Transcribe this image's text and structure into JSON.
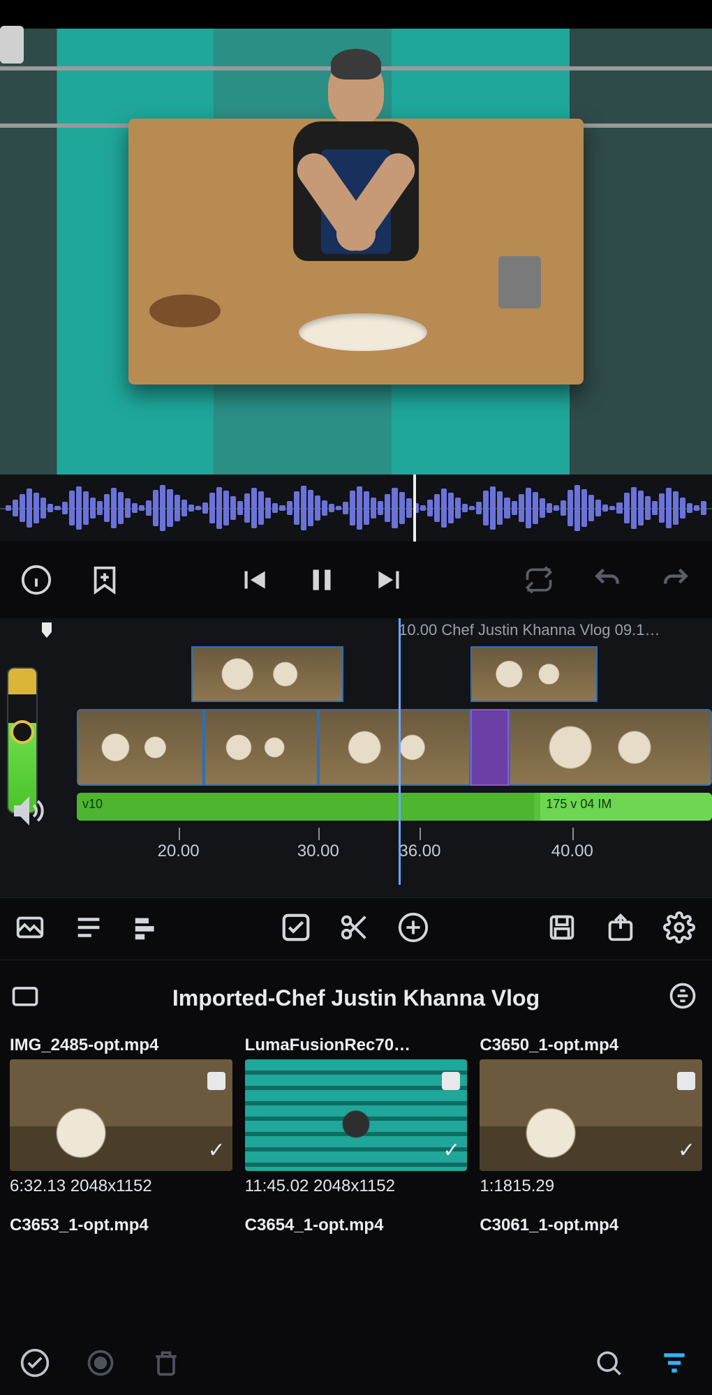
{
  "timeline": {
    "clip_label": "10.00  Chef Justin Khanna Vlog 09.1…",
    "ruler": [
      "20.00",
      "30.00",
      "36.00",
      "40.00"
    ],
    "audio_left_label": "v10",
    "audio_right_label": "175 v 04 IM"
  },
  "browser": {
    "title": "Imported-Chef Justin Khanna Vlog",
    "items": [
      {
        "name": "IMG_2485-opt.mp4",
        "meta": "6:32.13 2048x1152"
      },
      {
        "name": "LumaFusionRec70…",
        "meta": "11:45.02 2048x1152"
      },
      {
        "name": "C3650_1-opt.mp4",
        "meta": "1:1815.29"
      }
    ],
    "row2": [
      "C3653_1-opt.mp4",
      "C3654_1-opt.mp4",
      "C3061_1-opt.mp4"
    ]
  },
  "icons": {
    "info": "info-icon",
    "bookmark": "bookmark-add-icon",
    "prev": "skip-previous-icon",
    "pause": "pause-icon",
    "next": "skip-next-icon",
    "loop": "loop-icon",
    "undo": "undo-icon",
    "redo": "redo-icon",
    "speaker": "speaker-icon",
    "tool_image": "image-icon",
    "tool_list": "list-icon",
    "tool_align": "align-icon",
    "tool_check": "checkbox-icon",
    "tool_cut": "scissors-icon",
    "tool_add": "add-circle-icon",
    "tool_save": "save-icon",
    "tool_export": "export-icon",
    "tool_settings": "settings-icon",
    "folder": "folder-icon",
    "sort": "sort-icon",
    "select_all": "select-all-icon",
    "record": "record-icon",
    "delete": "trash-icon",
    "search": "search-icon",
    "filter": "filter-icon"
  }
}
